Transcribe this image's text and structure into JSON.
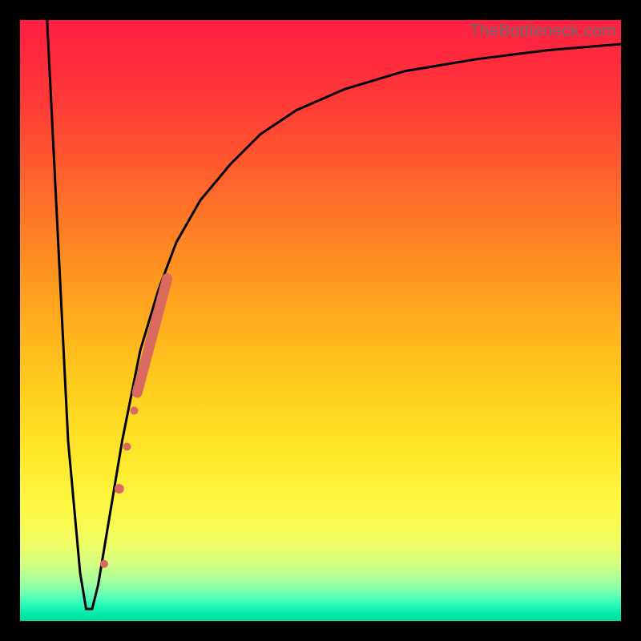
{
  "watermark": "TheBottleneck.com",
  "chart_data": {
    "type": "line",
    "title": "",
    "xlabel": "",
    "ylabel": "",
    "xlim": [
      0,
      100
    ],
    "ylim": [
      0,
      100
    ],
    "series": [
      {
        "name": "bottleneck-curve",
        "x": [
          4.5,
          6,
          8,
          10,
          11,
          12,
          13,
          14,
          15,
          17,
          20,
          23,
          26,
          30,
          35,
          40,
          46,
          54,
          64,
          76,
          88,
          100
        ],
        "values": [
          100,
          70,
          30,
          8,
          2,
          2,
          6,
          12,
          18,
          30,
          45,
          55,
          63,
          70,
          76,
          81,
          85,
          88.5,
          91.5,
          93.5,
          95,
          96
        ]
      }
    ],
    "markers": [
      {
        "name": "dot-1",
        "x": 14.0,
        "y": 9.5,
        "r": 5
      },
      {
        "name": "dot-2",
        "x": 16.5,
        "y": 22.0,
        "r": 6
      },
      {
        "name": "dot-3",
        "x": 17.8,
        "y": 29.0,
        "r": 5
      },
      {
        "name": "dot-4",
        "x": 19.0,
        "y": 35.0,
        "r": 5
      }
    ],
    "stroke_segment": {
      "name": "highlight-stroke",
      "x1": 19.5,
      "y1": 38.0,
      "x2": 24.5,
      "y2": 57.0,
      "width": 13
    },
    "colors": {
      "curve": "#000000",
      "marker": "#d96a60",
      "background_top": "#ff1f42",
      "background_bottom": "#00dd9f"
    }
  }
}
